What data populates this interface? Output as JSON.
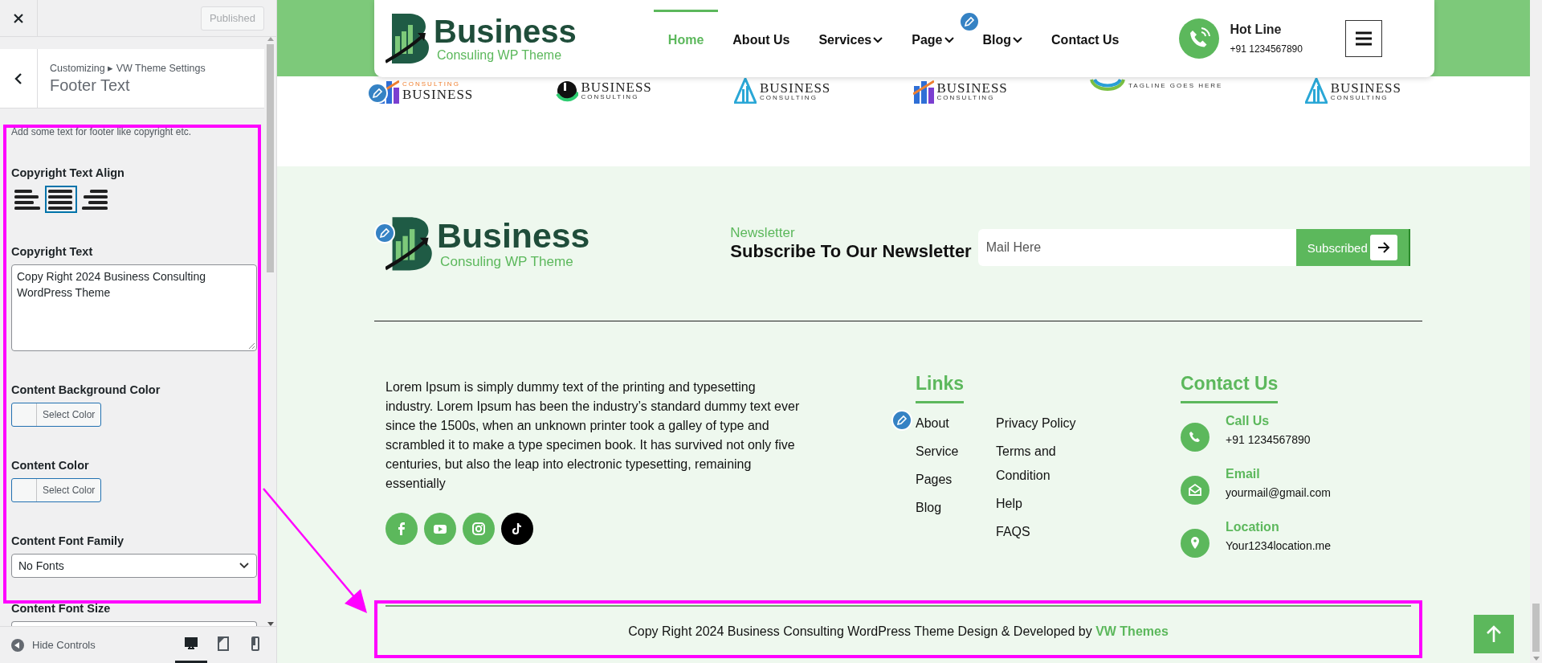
{
  "customizer": {
    "publish_button": "Published",
    "breadcrumb": "Customizing ▸ VW Theme Settings",
    "section_title": "Footer Text",
    "groups": [
      {
        "highlighted": true,
        "description": "Add some text for footer like copyright etc.",
        "controls": [
          {
            "kind": "align",
            "label": "Copyright Text Align",
            "options": [
              {
                "kind": "left",
                "selected": false
              },
              {
                "kind": "justify",
                "selected": true
              },
              {
                "kind": "right",
                "selected": false
              }
            ]
          },
          {
            "kind": "textarea",
            "label": "Copyright Text",
            "value": "Copy Right 2024 Business Consulting WordPress Theme"
          },
          {
            "kind": "color",
            "label": "Content Background Color",
            "button": "Select Color"
          },
          {
            "kind": "color",
            "label": "Content Color",
            "button": "Select Color"
          },
          {
            "kind": "select",
            "label": "Content Font Family",
            "value": "No Fonts"
          }
        ]
      },
      {
        "highlighted": false,
        "controls": [
          {
            "kind": "input",
            "label": "Content Font Size"
          }
        ]
      }
    ],
    "bottom_bar": {
      "hide_controls": "Hide Controls",
      "devices": [
        {
          "kind": "desktop",
          "selected": true
        },
        {
          "kind": "tablet",
          "selected": false
        },
        {
          "kind": "mobile",
          "selected": false
        }
      ]
    }
  },
  "preview": {
    "header": {
      "logo": {
        "name": "Business",
        "tagline": "Consuling WP Theme"
      },
      "nav": [
        {
          "label": "Home",
          "selected": true,
          "dropdown": false
        },
        {
          "label": "About Us",
          "selected": false,
          "dropdown": false
        },
        {
          "label": "Services",
          "selected": false,
          "dropdown": true
        },
        {
          "label": "Page",
          "selected": false,
          "dropdown": true
        },
        {
          "label": "Blog",
          "selected": false,
          "dropdown": true
        },
        {
          "label": "Contact Us",
          "selected": false,
          "dropdown": false
        }
      ],
      "hotline": {
        "label": "Hot Line",
        "number": "+91 1234567890"
      }
    },
    "partner_logos": [
      {
        "kind": "bars",
        "top": "CONSULTING",
        "name": "BUSINESS"
      },
      {
        "kind": "swoosh",
        "name": "BUSINESS",
        "sub": "CONSULTING"
      },
      {
        "kind": "tower",
        "name": "BUSINESS",
        "sub": "CONSULTING"
      },
      {
        "kind": "bars",
        "name": "BUSINESS",
        "sub": "CONSULTING"
      },
      {
        "kind": "globe",
        "sub": "TAGLINE GOES HERE"
      },
      {
        "kind": "tower",
        "name": "BUSINESS",
        "sub": "CONSULTING"
      }
    ],
    "footer": {
      "logo": {
        "name": "Business",
        "tagline": "Consuling WP Theme"
      },
      "newsletter": {
        "eyebrow": "Newsletter",
        "title": "Subscribe To Our Newsletter",
        "placeholder": "Mail Here",
        "button": "Subscribed"
      },
      "about": "Lorem Ipsum is simply dummy text of the printing and typesetting industry. Lorem Ipsum has been the industry’s standard dummy text ever since the 1500s, when an unknown printer took a galley of type and scrambled it to make a type specimen book. It has survived not only five centuries, but also the leap into electronic typesetting, remaining essentially",
      "social": [
        {
          "kind": "facebook",
          "color": "#5cb85c"
        },
        {
          "kind": "youtube",
          "color": "#5cb85c"
        },
        {
          "kind": "instagram",
          "color": "#5cb85c"
        },
        {
          "kind": "tiktok",
          "color": "#000000"
        }
      ],
      "links": {
        "title": "Links",
        "columns": [
          [
            "About",
            "Service",
            "Pages",
            "Blog"
          ],
          [
            "Privacy Policy",
            "Terms and Condition",
            "Help",
            "FAQS"
          ]
        ]
      },
      "contact": {
        "title": "Contact Us",
        "items": [
          {
            "kind": "phone",
            "label": "Call Us",
            "value": "+91 1234567890"
          },
          {
            "kind": "email",
            "label": "Email",
            "value": "yourmail@gmail.com"
          },
          {
            "kind": "location",
            "label": "Location",
            "value": "Your1234location.me"
          }
        ]
      },
      "copyright": {
        "highlighted": true,
        "text": "Copy Right 2024 Business Consulting WordPress Theme Design & Developed by ",
        "link": "VW Themes"
      }
    }
  },
  "annotation_arrow": true
}
